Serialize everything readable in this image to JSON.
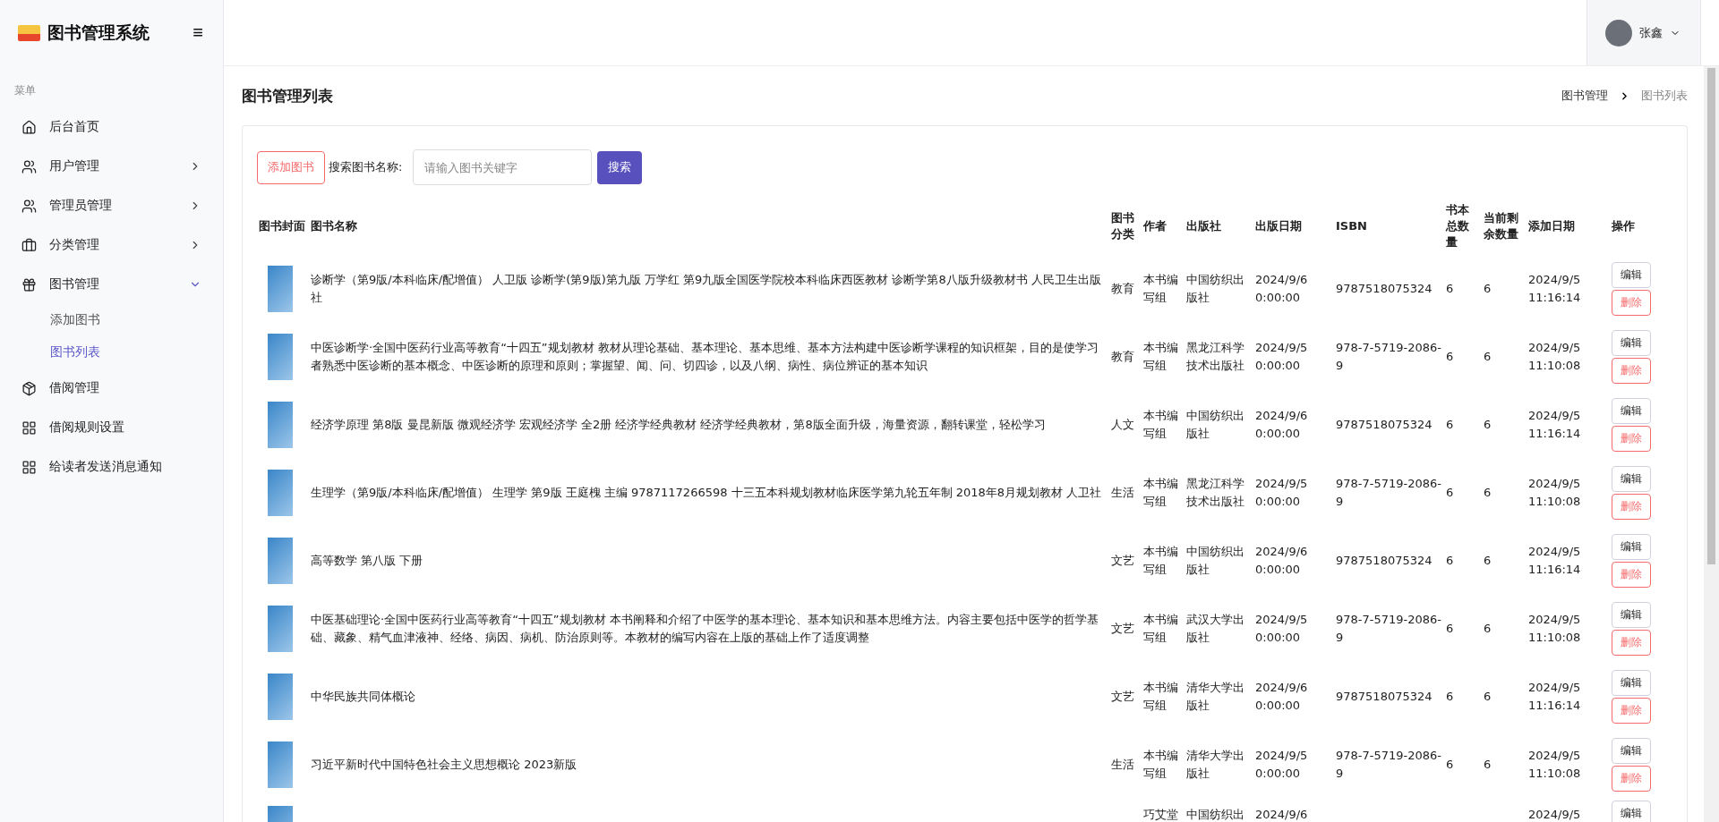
{
  "brand": {
    "title": "图书管理系统",
    "menu_toggle": "≡"
  },
  "user": {
    "name": "张鑫"
  },
  "sidebar": {
    "section": "菜单",
    "items": [
      {
        "label": "后台首页"
      },
      {
        "label": "用户管理",
        "expanded": false
      },
      {
        "label": "管理员管理",
        "expanded": false
      },
      {
        "label": "分类管理",
        "expanded": false
      },
      {
        "label": "图书管理",
        "expanded": true,
        "children": [
          {
            "label": "添加图书",
            "selected": false
          },
          {
            "label": "图书列表",
            "selected": true
          }
        ]
      },
      {
        "label": "借阅管理"
      },
      {
        "label": "借阅规则设置"
      },
      {
        "label": "给读者发送消息通知"
      }
    ]
  },
  "page": {
    "title": "图书管理列表",
    "breadcrumb": [
      "图书管理",
      "图书列表"
    ]
  },
  "toolbar": {
    "add_button": "添加图书",
    "search_label": "搜索图书名称:",
    "search_placeholder": "请输入图书关键字",
    "search_button": "搜索"
  },
  "table": {
    "columns": [
      "图书封面",
      "图书名称",
      "图书分类",
      "作者",
      "出版社",
      "出版日期",
      "ISBN",
      "书本总数量",
      "当前剩余数量",
      "添加日期",
      "操作"
    ],
    "rows": [
      {
        "name": "诊断学（第9版/本科临床/配增值） 人卫版 诊断学(第9版)第九版 万学红 第9九版全国医学院校本科临床西医教材 诊断学第8八版升级教材书 人民卫生出版社",
        "category": "教育",
        "author": "本书编写组",
        "publisher": "中国纺织出版社",
        "pub_date": "2024/9/6 0:00:00",
        "isbn": "9787518075324",
        "total": "6",
        "remaining": "6",
        "added": "2024/9/5 11:16:14",
        "edit": "编辑",
        "delete": "删除"
      },
      {
        "name": "中医诊断学·全国中医药行业高等教育“十四五”规划教材 教材从理论基础、基本理论、基本思维、基本方法构建中医诊断学课程的知识框架，目的是使学习者熟悉中医诊断的基本概念、中医诊断的原理和原则；掌握望、闻、问、切四诊，以及八纲、病性、病位辨证的基本知识",
        "category": "教育",
        "author": "本书编写组",
        "publisher": "黑龙江科学技术出版社",
        "pub_date": "2024/9/5 0:00:00",
        "isbn": "978-7-5719-2086-9",
        "total": "6",
        "remaining": "6",
        "added": "2024/9/5 11:10:08",
        "edit": "编辑",
        "delete": "删除"
      },
      {
        "name": "经济学原理 第8版 曼昆新版 微观经济学 宏观经济学 全2册 经济学经典教材 经济学经典教材，第8版全面升级，海量资源，翻转课堂，轻松学习",
        "category": "人文",
        "author": "本书编写组",
        "publisher": "中国纺织出版社",
        "pub_date": "2024/9/6 0:00:00",
        "isbn": "9787518075324",
        "total": "6",
        "remaining": "6",
        "added": "2024/9/5 11:16:14",
        "edit": "编辑",
        "delete": "删除"
      },
      {
        "name": "生理学（第9版/本科临床/配增值） 生理学 第9版 王庭槐 主编 9787117266598 十三五本科规划教材临床医学第九轮五年制 2018年8月规划教材 人卫社",
        "category": "生活",
        "author": "本书编写组",
        "publisher": "黑龙江科学技术出版社",
        "pub_date": "2024/9/5 0:00:00",
        "isbn": "978-7-5719-2086-9",
        "total": "6",
        "remaining": "6",
        "added": "2024/9/5 11:10:08",
        "edit": "编辑",
        "delete": "删除"
      },
      {
        "name": "高等数学 第八版 下册",
        "category": "文艺",
        "author": "本书编写组",
        "publisher": "中国纺织出版社",
        "pub_date": "2024/9/6 0:00:00",
        "isbn": "9787518075324",
        "total": "6",
        "remaining": "6",
        "added": "2024/9/5 11:16:14",
        "edit": "编辑",
        "delete": "删除"
      },
      {
        "name": "中医基础理论·全国中医药行业高等教育“十四五”规划教材 本书阐释和介绍了中医学的基本理论、基本知识和基本思维方法。内容主要包括中医学的哲学基础、藏象、精气血津液神、经络、病因、病机、防治原则等。本教材的编写内容在上版的基础上作了适度调整",
        "category": "文艺",
        "author": "本书编写组",
        "publisher": "武汉大学出版社",
        "pub_date": "2024/9/5 0:00:00",
        "isbn": "978-7-5719-2086-9",
        "total": "6",
        "remaining": "6",
        "added": "2024/9/5 11:10:08",
        "edit": "编辑",
        "delete": "删除"
      },
      {
        "name": "中华民族共同体概论",
        "category": "文艺",
        "author": "本书编写组",
        "publisher": "清华大学出版社",
        "pub_date": "2024/9/6 0:00:00",
        "isbn": "9787518075324",
        "total": "6",
        "remaining": "6",
        "added": "2024/9/5 11:16:14",
        "edit": "编辑",
        "delete": "删除"
      },
      {
        "name": "习近平新时代中国特色社会主义思想概论 2023新版",
        "category": "生活",
        "author": "本书编写组",
        "publisher": "清华大学出版社",
        "pub_date": "2024/9/5 0:00:00",
        "isbn": "978-7-5719-2086-9",
        "total": "6",
        "remaining": "6",
        "added": "2024/9/5 11:10:08",
        "edit": "编辑",
        "delete": "删除"
      }
    ],
    "partial_row": {
      "author": "巧艾堂",
      "publisher": "中国纺织出",
      "pub_date": "2024/9/6",
      "added": "2024/9/5",
      "edit": "编辑"
    }
  }
}
